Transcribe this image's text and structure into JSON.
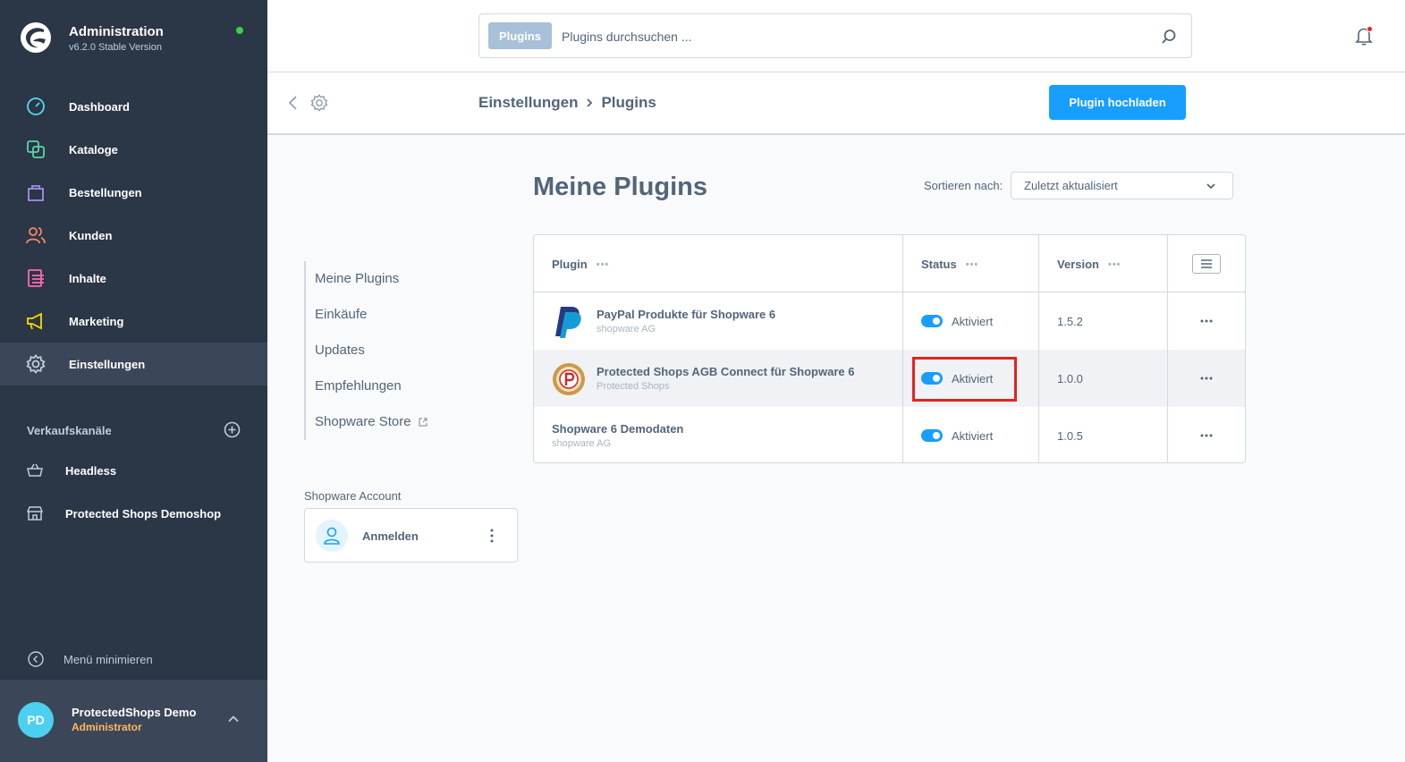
{
  "app": {
    "title": "Administration",
    "version": "v6.2.0 Stable Version",
    "colors": {
      "sidebar": "#2b3646",
      "accent": "#189eff",
      "online": "#37d046",
      "highlight": "#e5231b"
    }
  },
  "sidebar": {
    "items": [
      {
        "label": "Dashboard",
        "icon": "gauge-icon",
        "color": "#57d9f2"
      },
      {
        "label": "Kataloge",
        "icon": "catalog-icon",
        "color": "#57d9a3"
      },
      {
        "label": "Bestellungen",
        "icon": "shopping-bag-icon",
        "color": "#a092f0"
      },
      {
        "label": "Kunden",
        "icon": "users-icon",
        "color": "#f88962"
      },
      {
        "label": "Inhalte",
        "icon": "content-icon",
        "color": "#ff68b4"
      },
      {
        "label": "Marketing",
        "icon": "megaphone-icon",
        "color": "#ffd700"
      },
      {
        "label": "Einstellungen",
        "icon": "gear-icon",
        "color": "#c3ccd6"
      }
    ],
    "channels_title": "Verkaufskanäle",
    "channels": [
      {
        "label": "Headless",
        "icon": "basket-icon"
      },
      {
        "label": "Protected Shops Demoshop",
        "icon": "storefront-icon"
      }
    ],
    "minimize_label": "Menü minimieren",
    "user": {
      "initials": "PD",
      "name": "ProtectedShops Demo",
      "role": "Administrator"
    }
  },
  "header": {
    "search_tag": "Plugins",
    "search_placeholder": "Plugins durchsuchen ..."
  },
  "subheader": {
    "breadcrumb": [
      "Einstellungen",
      "Plugins"
    ],
    "upload_label": "Plugin hochladen"
  },
  "main": {
    "title": "Meine Plugins",
    "sort_label": "Sortieren nach:",
    "sort_value": "Zuletzt aktualisiert",
    "subnav": [
      "Meine Plugins",
      "Einkäufe",
      "Updates",
      "Empfehlungen",
      "Shopware Store"
    ],
    "account_title": "Shopware Account",
    "account_login": "Anmelden",
    "table": {
      "columns": [
        "Plugin",
        "Status",
        "Version"
      ],
      "rows": [
        {
          "name": "PayPal Produkte für Shopware 6",
          "vendor": "shopware AG",
          "status": "Aktiviert",
          "version": "1.5.2"
        },
        {
          "name": "Protected Shops AGB Connect für Shopware 6",
          "vendor": "Protected Shops",
          "status": "Aktiviert",
          "version": "1.0.0"
        },
        {
          "name": "Shopware 6 Demodaten",
          "vendor": "shopware AG",
          "status": "Aktiviert",
          "version": "1.0.5"
        }
      ]
    }
  }
}
